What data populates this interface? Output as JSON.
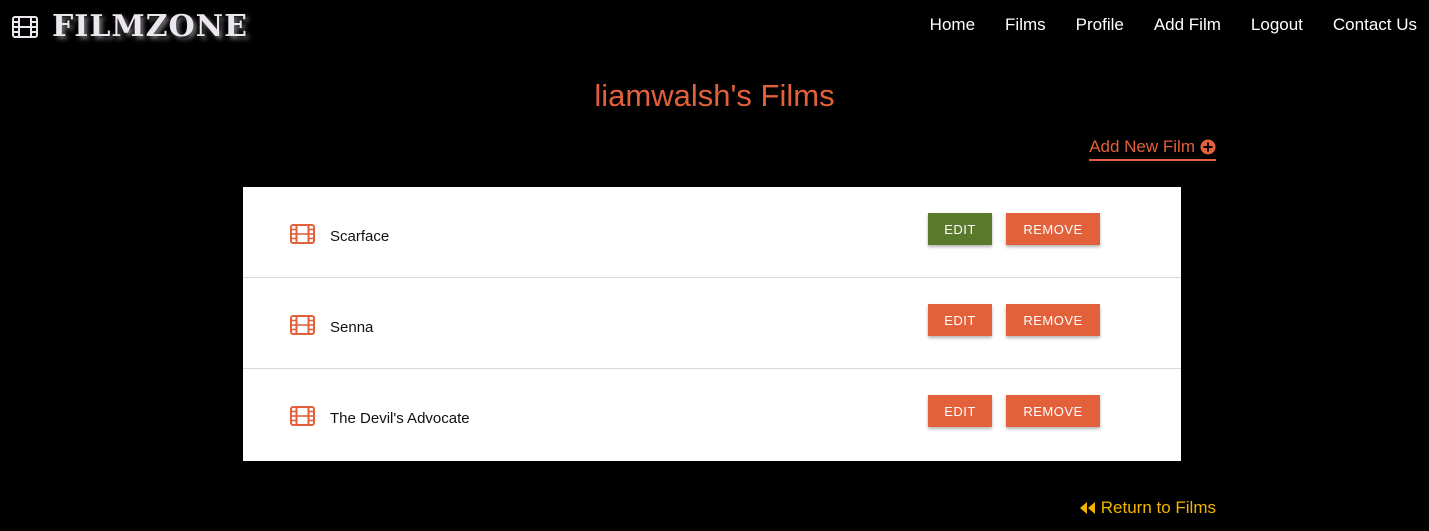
{
  "header": {
    "brand": "FILMZONE",
    "brand_icon": "film-icon",
    "nav": [
      {
        "label": "Home"
      },
      {
        "label": "Films"
      },
      {
        "label": "Profile"
      },
      {
        "label": "Add Film"
      },
      {
        "label": "Logout"
      },
      {
        "label": "Contact Us"
      }
    ]
  },
  "main": {
    "title": "liamwalsh's Films",
    "add_link": {
      "label": "Add New Film",
      "icon": "plus-circle-icon"
    },
    "films": [
      {
        "title": "Scarface",
        "edit_label": "EDIT",
        "remove_label": "REMOVE",
        "edit_state": "active"
      },
      {
        "title": "Senna",
        "edit_label": "EDIT",
        "remove_label": "REMOVE",
        "edit_state": "default"
      },
      {
        "title": "The Devil's Advocate",
        "edit_label": "EDIT",
        "remove_label": "REMOVE",
        "edit_state": "default"
      }
    ],
    "return_link": {
      "label": "Return to Films",
      "icon": "backward-icon"
    }
  },
  "colors": {
    "background": "#000000",
    "accent": "#e2603a",
    "active_edit": "#5a7a2b",
    "return_link": "#f2b400",
    "card": "#ffffff"
  }
}
